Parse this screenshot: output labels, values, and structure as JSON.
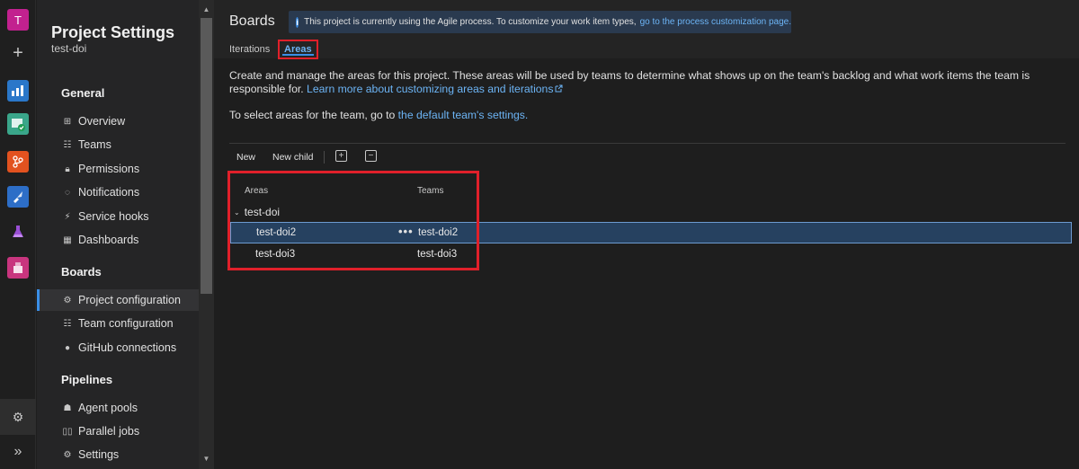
{
  "rail": {
    "avatar_letter": "T",
    "plus_glyph": "+",
    "icons": [
      "overview-icon",
      "boards-icon",
      "repos-icon",
      "pipelines-icon",
      "test-plans-icon",
      "artifacts-icon"
    ],
    "settings_icon": "gear-icon",
    "expand_icon": "double-chevron-right-icon"
  },
  "nav": {
    "title": "Project Settings",
    "project": "test-doi",
    "sections": {
      "general": "General",
      "boards": "Boards",
      "pipelines": "Pipelines"
    },
    "general_items": [
      {
        "label": "Overview",
        "icon": "grid-icon"
      },
      {
        "label": "Teams",
        "icon": "people-icon"
      },
      {
        "label": "Permissions",
        "icon": "lock-icon"
      },
      {
        "label": "Notifications",
        "icon": "chat-icon"
      },
      {
        "label": "Service hooks",
        "icon": "hook-icon"
      },
      {
        "label": "Dashboards",
        "icon": "dashboard-icon"
      }
    ],
    "boards_items": [
      {
        "label": "Project configuration",
        "icon": "config-icon"
      },
      {
        "label": "Team configuration",
        "icon": "team-config-icon"
      },
      {
        "label": "GitHub connections",
        "icon": "github-icon"
      }
    ],
    "pipelines_items": [
      {
        "label": "Agent pools",
        "icon": "agent-icon"
      },
      {
        "label": "Parallel jobs",
        "icon": "parallel-icon"
      },
      {
        "label": "Settings",
        "icon": "gear-icon"
      }
    ]
  },
  "header": {
    "title": "Boards",
    "banner_text": "This project is currently using the Agile process. To customize your work item types,",
    "banner_link": "go to the process customization page.",
    "tabs": {
      "iterations": "Iterations",
      "areas": "Areas"
    }
  },
  "content": {
    "description": "Create and manage the areas for this project. These areas will be used by teams to determine what shows up on the team's backlog and what work items the team is responsible for.",
    "learn_more": "Learn more about customizing areas and iterations",
    "select_text": "To select areas for the team, go to",
    "select_link": "the default team's settings."
  },
  "toolbar": {
    "new_label": "New",
    "new_child_label": "New child",
    "expand_glyph": "+",
    "collapse_glyph": "−"
  },
  "tree": {
    "columns": {
      "areas": "Areas",
      "teams": "Teams"
    },
    "root": "test-doi",
    "rows": [
      {
        "area": "test-doi2",
        "team": "test-doi2",
        "more": "•••"
      },
      {
        "area": "test-doi3",
        "team": "test-doi3"
      }
    ]
  },
  "colors": {
    "accent": "#3a8ee6",
    "link": "#6cb4f5",
    "highlight": "#e0202a",
    "selected_row": "#264160"
  }
}
